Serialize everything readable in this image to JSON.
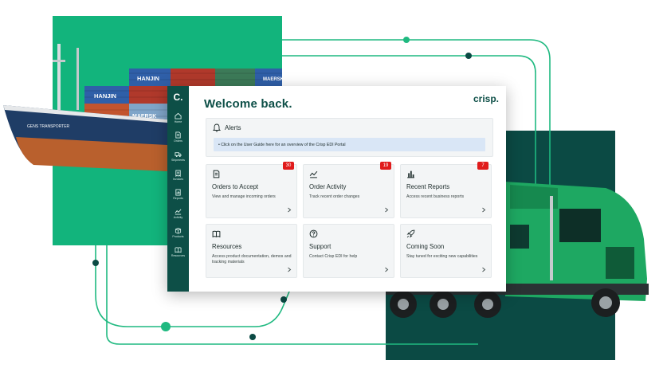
{
  "sidebar": {
    "logo": "C.",
    "items": [
      {
        "label": "Home",
        "icon": "home-icon"
      },
      {
        "label": "Orders",
        "icon": "document-icon"
      },
      {
        "label": "Shipments",
        "icon": "truck-icon"
      },
      {
        "label": "Invoices",
        "icon": "invoice-icon"
      },
      {
        "label": "Reports",
        "icon": "report-icon"
      },
      {
        "label": "Activity",
        "icon": "activity-icon"
      },
      {
        "label": "Products",
        "icon": "box-icon"
      },
      {
        "label": "Resources",
        "icon": "book-icon"
      }
    ]
  },
  "header": {
    "title": "Welcome back.",
    "brand": "crisp."
  },
  "alerts": {
    "title": "Alerts",
    "icon": "bell-icon",
    "message": "• Click on the User Guide here for an overview of the Crisp EDI Portal"
  },
  "cards": [
    {
      "title": "Orders to Accept",
      "description": "View and manage incoming orders",
      "badge": "30",
      "icon": "document-icon"
    },
    {
      "title": "Order Activity",
      "description": "Track recent order changes",
      "badge": "19",
      "icon": "activity-icon"
    },
    {
      "title": "Recent Reports",
      "description": "Access recent business reports",
      "badge": "7",
      "icon": "bar-chart-icon"
    },
    {
      "title": "Resources",
      "description": "Access product documentation, demos and tracking materials",
      "badge": "",
      "icon": "book-icon"
    },
    {
      "title": "Support",
      "description": "Contact Crisp EDI for help",
      "badge": "",
      "icon": "help-icon"
    },
    {
      "title": "Coming Soon",
      "description": "Stay tuned for exciting new capabilities",
      "badge": "",
      "icon": "rocket-icon"
    }
  ],
  "ship": {
    "containers": [
      "HANJIN",
      "HANJIN",
      "MAERSK",
      "MAERSK"
    ],
    "hull_name": "GENS TRANSPORTER"
  },
  "colors": {
    "brand_green": "#12b47c",
    "dark_teal": "#0b4a44",
    "sidebar": "#0d4f47",
    "badge_red": "#e01b1b",
    "alert_row": "#d9e6f6"
  }
}
